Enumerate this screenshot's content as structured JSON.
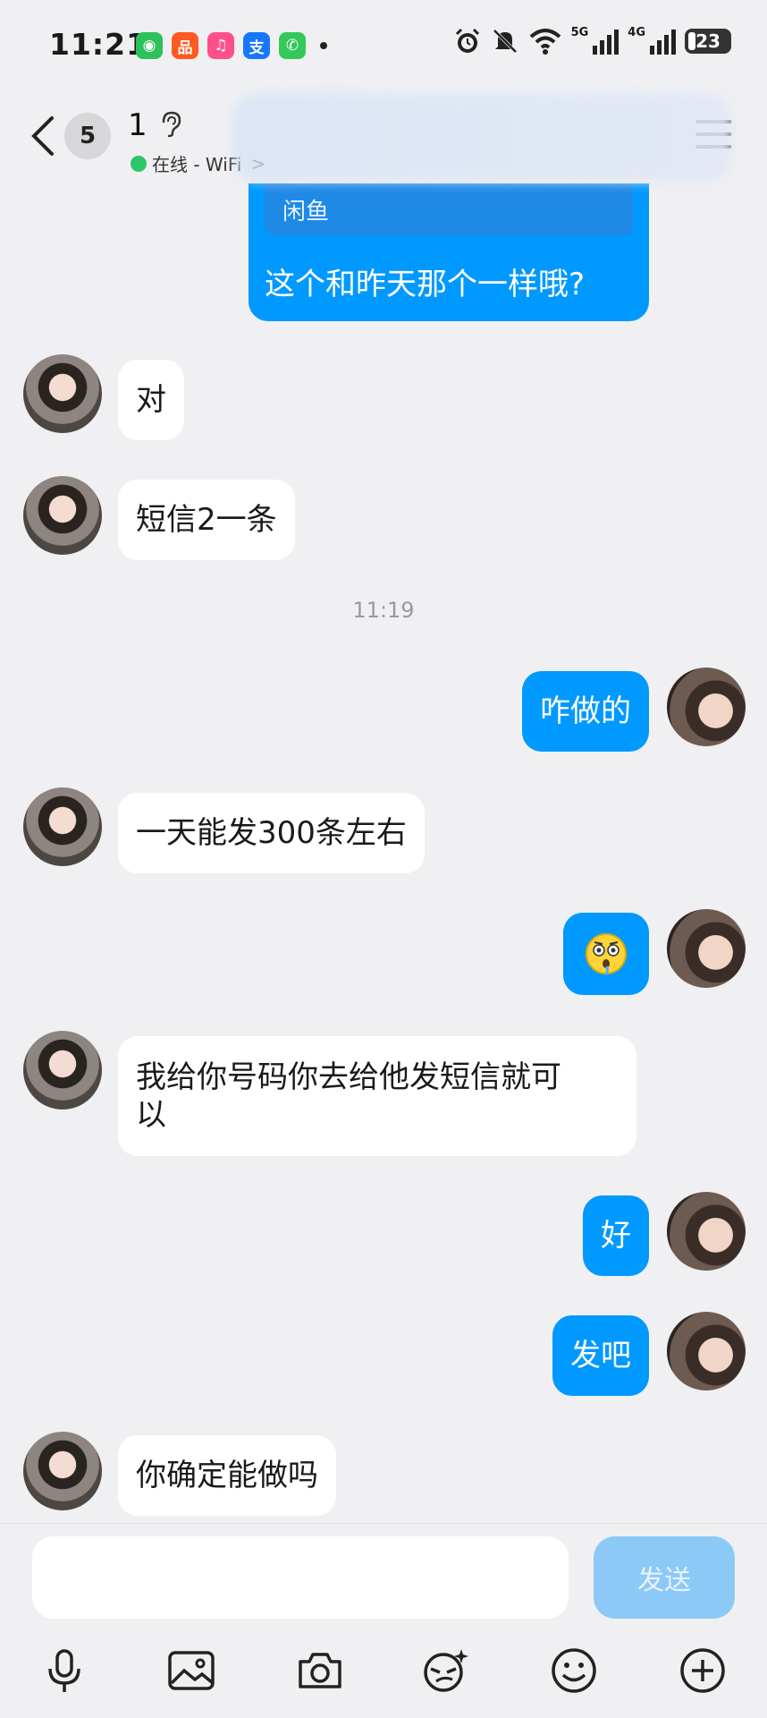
{
  "status_bar": {
    "time": "11:21",
    "network_5g": "5G",
    "network_4g": "4G",
    "battery": "23"
  },
  "header": {
    "unread_count": "5",
    "contact_name": "1",
    "online_status": "在线 - WiFi",
    "online_chevron": ">"
  },
  "quoted": {
    "source": "闲鱼",
    "text": "这个和昨天那个一样哦?"
  },
  "messages": [
    {
      "side": "in",
      "text": "对"
    },
    {
      "side": "in",
      "text": "短信2一条"
    },
    {
      "side": "out",
      "text": "咋做的"
    },
    {
      "side": "in",
      "text": "一天能发300条左右"
    },
    {
      "side": "out",
      "text": "",
      "emoji": "flushed-face"
    },
    {
      "side": "in",
      "text": "我给你号码你去给他发短信就可\n以"
    },
    {
      "side": "out",
      "text": "好"
    },
    {
      "side": "out",
      "text": "发吧"
    },
    {
      "side": "in",
      "text": "你确定能做吗"
    }
  ],
  "timestamp": "11:19",
  "input": {
    "placeholder": "",
    "send_label": "发送"
  },
  "toolbar": [
    "microphone-icon",
    "image-icon",
    "camera-icon",
    "sticker-icon",
    "emoji-icon",
    "plus-icon"
  ]
}
